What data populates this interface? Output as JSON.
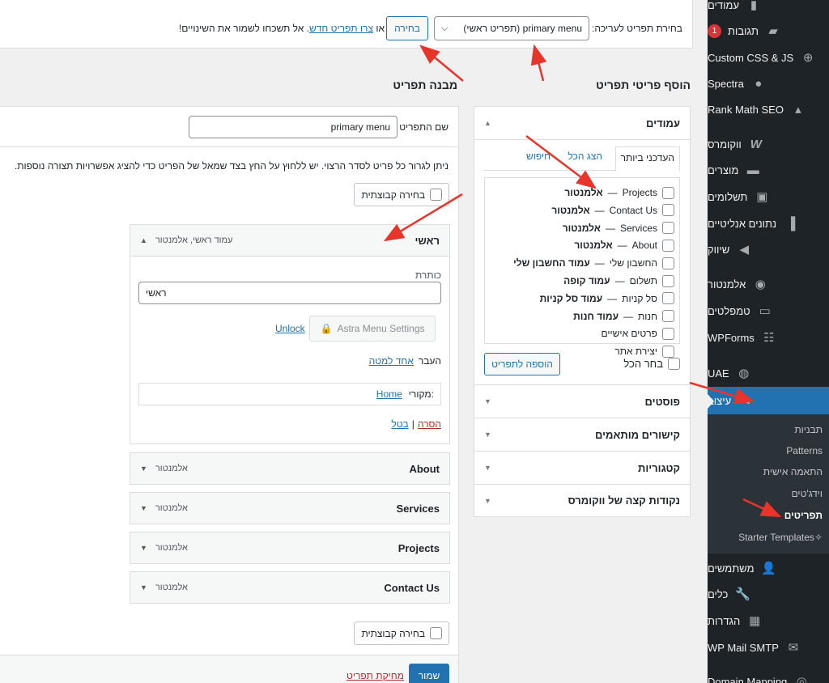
{
  "sidebar": {
    "items": [
      {
        "label": "עמודים",
        "icon": "pages-icon"
      },
      {
        "label": "תגובות",
        "icon": "comments-icon",
        "badge": "1"
      },
      {
        "label": "Custom CSS & JS",
        "icon": "plus-circle-icon"
      },
      {
        "label": "Spectra",
        "icon": "spectra-icon"
      },
      {
        "label": "Rank Math SEO",
        "icon": "rankmath-icon"
      },
      {
        "label": "ווקומרס",
        "icon": "woo-icon"
      },
      {
        "label": "מוצרים",
        "icon": "archive-icon"
      },
      {
        "label": "תשלומים",
        "icon": "payments-icon"
      },
      {
        "label": "נתונים אנליטיים",
        "icon": "analytics-icon"
      },
      {
        "label": "שיווק",
        "icon": "megaphone-icon"
      },
      {
        "label": "אלמנטור",
        "icon": "elementor-icon"
      },
      {
        "label": "טמפלטים",
        "icon": "folder-icon"
      },
      {
        "label": "WPForms",
        "icon": "forms-icon"
      },
      {
        "label": "UAE",
        "icon": "uae-icon"
      },
      {
        "label": "עיצוב",
        "icon": "brush-icon"
      },
      {
        "label": "משתמשים",
        "icon": "users-icon"
      },
      {
        "label": "כלים",
        "icon": "wrench-icon"
      },
      {
        "label": "הגדרות",
        "icon": "settings-icon"
      },
      {
        "label": "WP Mail SMTP",
        "icon": "mail-icon"
      },
      {
        "label": "Domain Mapping",
        "icon": "globe-icon"
      }
    ],
    "submenu": [
      "תבניות",
      "Patterns",
      "התאמה אישית",
      "וידג'טים",
      "תפריטים",
      "Starter Templates"
    ]
  },
  "topbar": {
    "label": "בחירת תפריט לעריכה:",
    "select_value": "primary menu (תפריט ראשי)",
    "select_button": "בחירה",
    "note_or": "או",
    "note_link": "צרו תפריט חדש",
    "note_rest": ". אל תשכחו לשמור את השינויים!"
  },
  "add_items": {
    "heading": "הוסף פריטי תפריט",
    "pages_title": "עמודים",
    "tabs": [
      "העדכני ביותר",
      "הצג הכל",
      "חיפוש"
    ],
    "pages": [
      {
        "title": "Projects",
        "sep": " — ",
        "tag": "אלמנטור"
      },
      {
        "title": "Contact Us",
        "sep": " — ",
        "tag": "אלמנטור"
      },
      {
        "title": "Services",
        "sep": " — ",
        "tag": "אלמנטור"
      },
      {
        "title": "About",
        "sep": " — ",
        "tag": "אלמנטור"
      },
      {
        "title": "החשבון שלי",
        "sep": " — ",
        "tag": "עמוד החשבון שלי"
      },
      {
        "title": "תשלום",
        "sep": " — ",
        "tag": "עמוד קופה"
      },
      {
        "title": "סל קניות",
        "sep": " — ",
        "tag": "עמוד סל קניות"
      },
      {
        "title": "חנות",
        "sep": " — ",
        "tag": "עמוד חנות"
      },
      {
        "title": "פרטים אישיים",
        "sep": "",
        "tag": ""
      },
      {
        "title": "יצירת אתר",
        "sep": "",
        "tag": ""
      }
    ],
    "select_all": "בחר הכל",
    "add_button": "הוספה לתפריט",
    "sections": [
      "פוסטים",
      "קישורים מותאמים",
      "קטגוריות",
      "נקודות קצה של ווקומרס"
    ]
  },
  "structure": {
    "heading": "מבנה תפריט",
    "name_label": "שם התפריט",
    "name_value": "primary menu",
    "instructions": "ניתן לגרור כל פריט לסדר הרצוי. יש ללחוץ על החץ בצד שמאל של הפריט כדי להציג אפשרויות תצורה נוספות.",
    "bulk_select": "בחירה קבוצתית",
    "expanded_item": {
      "title": "ראשי",
      "meta": "עמוד ראשי, אלמנטור",
      "label_caption": "כותרת",
      "label_value": "ראשי",
      "astra_button": "Astra Menu Settings",
      "unlock": "Unlock",
      "move_label": "העבר",
      "move_link": "אחד למטה",
      "source_label": "מקורי:",
      "source_link": "Home",
      "remove": "הסרה",
      "cancel": "בטל",
      "pipe": "|"
    },
    "items": [
      {
        "title": "About",
        "meta": "אלמנטור"
      },
      {
        "title": "Services",
        "meta": "אלמנטור"
      },
      {
        "title": "Projects",
        "meta": "אלמנטור"
      },
      {
        "title": "Contact Us",
        "meta": "אלמנטור"
      }
    ],
    "save_button": "שמור",
    "delete_link": "מחיקת תפריט"
  },
  "colors": {
    "accent": "#2271b1",
    "sidebar": "#1d2327",
    "arrow": "#e8352b"
  }
}
